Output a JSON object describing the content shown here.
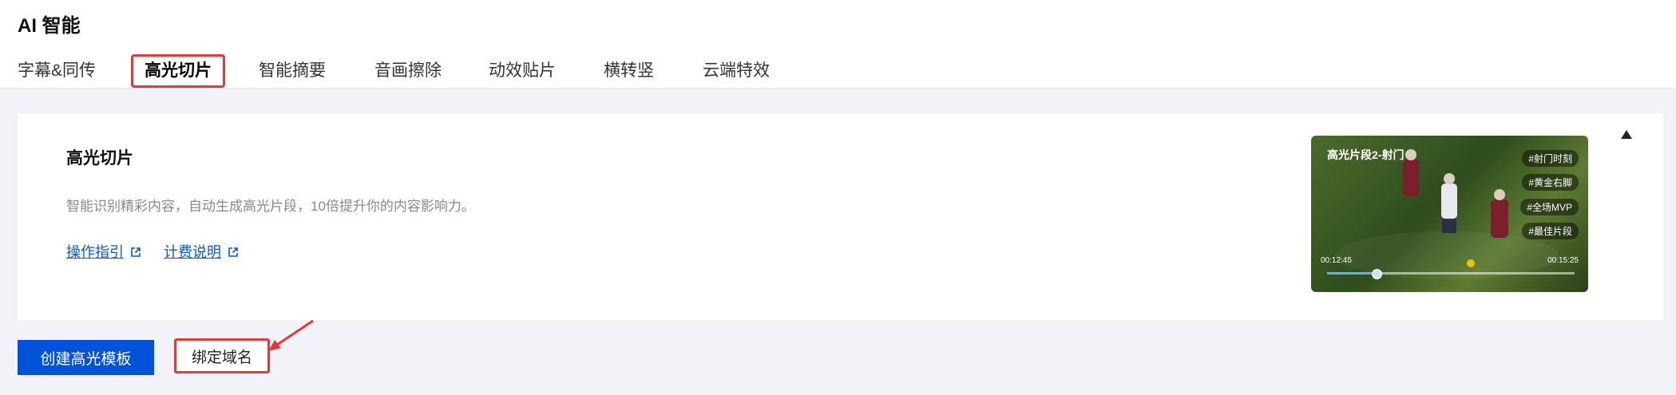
{
  "header": {
    "title": "AI 智能",
    "tabs": [
      {
        "label": "字幕&同传",
        "active": false
      },
      {
        "label": "高光切片",
        "active": true
      },
      {
        "label": "智能摘要",
        "active": false
      },
      {
        "label": "音画擦除",
        "active": false
      },
      {
        "label": "动效贴片",
        "active": false
      },
      {
        "label": "横转竖",
        "active": false
      },
      {
        "label": "云端特效",
        "active": false
      }
    ]
  },
  "card": {
    "title": "高光切片",
    "description": "智能识别精彩内容，自动生成高光片段，10倍提升你的内容影响力。",
    "links": {
      "guide": "操作指引",
      "billing": "计费说明"
    },
    "collapse_icon": "caret-up-icon",
    "preview": {
      "title": "高光片段2-射门",
      "tags": [
        "#射门时刻",
        "#黄金右脚",
        "#全场MVP",
        "#最佳片段"
      ],
      "time_start": "00:12:45",
      "time_end": "00:15:25",
      "progress_fraction": 0.2
    }
  },
  "actions": {
    "create_button": "创建高光模板",
    "bind_button": "绑定域名"
  },
  "colors": {
    "accent_blue": "#0052d9",
    "link_blue": "#0b57d0",
    "highlight_red": "#e53935",
    "page_background": "#f2f3f8"
  }
}
